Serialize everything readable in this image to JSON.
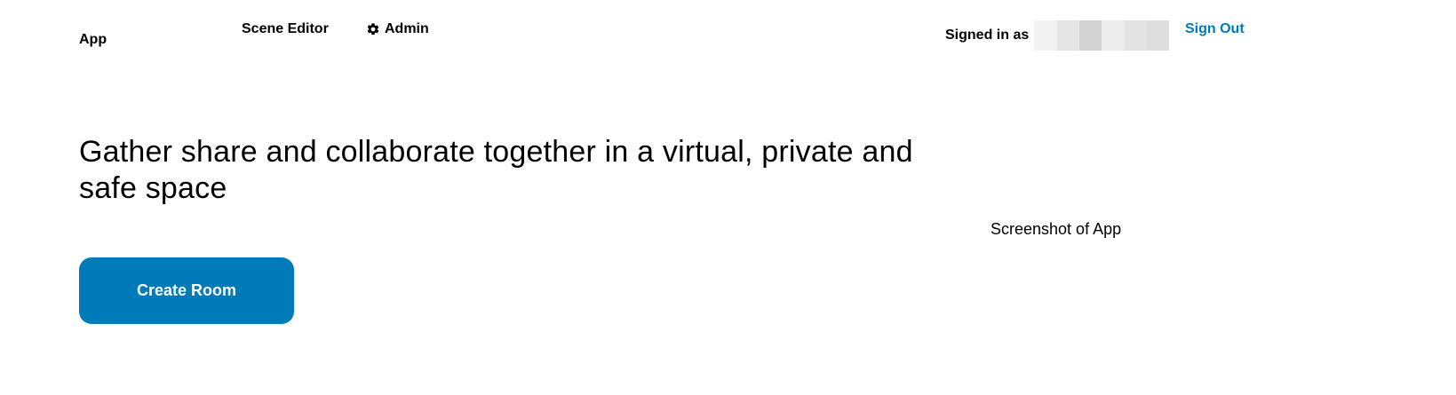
{
  "header": {
    "brand": "App",
    "nav": [
      {
        "label": "Scene Editor",
        "icon": ""
      },
      {
        "label": "Admin",
        "icon": "gear-icon"
      }
    ],
    "signed_in_label": "Signed in as",
    "sign_out_label": "Sign Out"
  },
  "hero": {
    "headline": "Gather share and collaborate together in a virtual, private and safe space",
    "cta_label": "Create Room",
    "screenshot_alt": "Screenshot of App"
  },
  "colors": {
    "accent": "#007AB8",
    "text": "#000000",
    "background": "#FFFFFF"
  }
}
